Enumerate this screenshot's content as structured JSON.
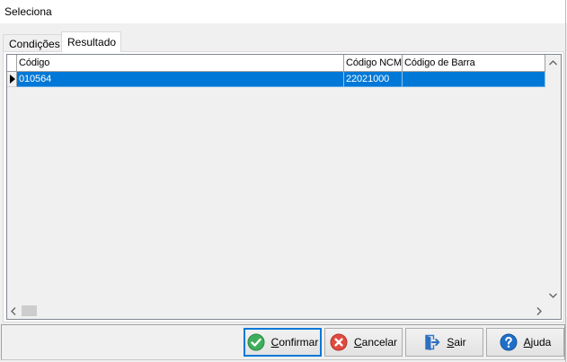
{
  "window": {
    "title": "Seleciona"
  },
  "tabs": [
    {
      "label": "Condições",
      "selected": false
    },
    {
      "label": "Resultado",
      "selected": true
    }
  ],
  "grid": {
    "columns": [
      "Código",
      "Código NCM",
      "Código de Barra"
    ],
    "rows": [
      {
        "codigo": "010564",
        "codigo_ncm": "22021000",
        "codigo_de_barra": "",
        "selected": true
      }
    ]
  },
  "buttons": [
    {
      "label": "Confirmar",
      "icon": "confirm-check-icon",
      "focused": true
    },
    {
      "label": "Cancelar",
      "icon": "cancel-x-icon",
      "focused": false
    },
    {
      "label": "Sair",
      "icon": "exit-door-icon",
      "focused": false
    },
    {
      "label": "Ajuda",
      "icon": "help-question-icon",
      "focused": false
    }
  ],
  "colors": {
    "selection": "#0078d7",
    "selection_text": "#ffffff",
    "focus_border": "#0078d7",
    "confirm_icon": "#3fae5a",
    "cancel_icon": "#e04a3f",
    "exit_icon": "#2f6fc0",
    "help_icon": "#1f6fc8"
  }
}
